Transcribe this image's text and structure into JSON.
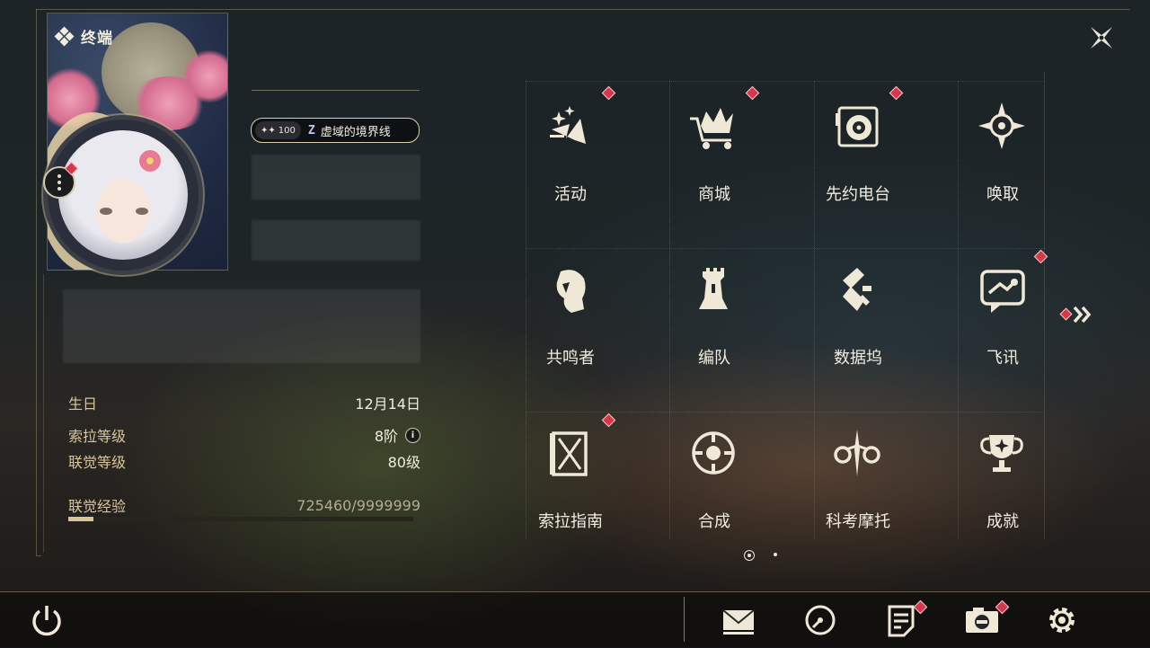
{
  "header": {
    "title": "终端"
  },
  "profile": {
    "badge": {
      "level": "100",
      "symbol": "Z",
      "title_name": "虚域的境界线"
    }
  },
  "stats": [
    {
      "label": "生日",
      "value": "12月14日"
    },
    {
      "label": "索拉等级",
      "value": "8阶"
    },
    {
      "label": "联觉等级",
      "value": "80级"
    }
  ],
  "experience": {
    "label": "联觉经验",
    "value": "725460/9999999",
    "progress_fraction": 0.0726
  },
  "menu": [
    {
      "label": "活动",
      "icon": "activity-icon",
      "notify": true
    },
    {
      "label": "商城",
      "icon": "shop-crown-cart-icon",
      "notify": true
    },
    {
      "label": "先约电台",
      "icon": "radio-disc-icon",
      "notify": true
    },
    {
      "label": "唤取",
      "icon": "summon-compass-icon",
      "notify": false
    },
    {
      "label": "共鸣者",
      "icon": "resonator-head-icon",
      "notify": false
    },
    {
      "label": "编队",
      "icon": "chess-team-icon",
      "notify": false
    },
    {
      "label": "数据坞",
      "icon": "data-dock-icon",
      "notify": false
    },
    {
      "label": "飞讯",
      "icon": "message-bubble-icon",
      "notify": true
    },
    {
      "label": "索拉指南",
      "icon": "guide-book-icon",
      "notify": true
    },
    {
      "label": "合成",
      "icon": "synthesis-icon",
      "notify": false
    },
    {
      "label": "科考摩托",
      "icon": "motorbike-icon",
      "notify": false
    },
    {
      "label": "成就",
      "icon": "trophy-icon",
      "notify": false
    }
  ],
  "pagination": {
    "current": 1,
    "total": 2
  },
  "bottom_bar": [
    {
      "name": "power-icon"
    },
    {
      "name": "mail-icon",
      "notify": false
    },
    {
      "name": "clock-icon",
      "notify": false
    },
    {
      "name": "notice-icon",
      "notify": true
    },
    {
      "name": "camera-icon",
      "notify": true
    },
    {
      "name": "settings-gear-icon",
      "notify": false
    }
  ],
  "colors": {
    "accent_gold": "#d9c597",
    "notify_red": "#d23a4c",
    "text": "#f1ece0"
  }
}
